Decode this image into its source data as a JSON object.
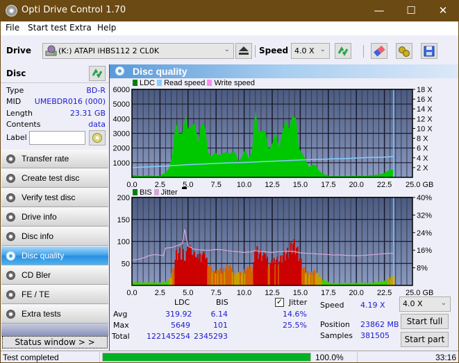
{
  "window": {
    "title": "Opti Drive Control 1.70",
    "controls": {
      "minimize": "—",
      "maximize": "☐",
      "close": "✕"
    }
  },
  "menu": [
    "File",
    "Start test",
    "Extra",
    "Help"
  ],
  "toolbar": {
    "drive_label": "Drive",
    "drive_value": "(K:)  ATAPI iHBS112  2 CL0K",
    "speed_label": "Speed",
    "speed_value": "4.0 X",
    "icons": [
      "drive-icon",
      "eject-icon",
      "refresh-icon",
      "eraser-icon",
      "settings-icon",
      "save-icon"
    ]
  },
  "disc": {
    "header": "Disc",
    "rows": [
      {
        "key": "Type",
        "value": "BD-R"
      },
      {
        "key": "MID",
        "value": "UMEBDR016 (000)"
      },
      {
        "key": "Length",
        "value": "23.31 GB"
      },
      {
        "key": "Contents",
        "value": "data"
      }
    ],
    "label_key": "Label",
    "label_value": ""
  },
  "nav": [
    {
      "label": "Transfer rate",
      "active": false
    },
    {
      "label": "Create test disc",
      "active": false
    },
    {
      "label": "Verify test disc",
      "active": false
    },
    {
      "label": "Drive info",
      "active": false
    },
    {
      "label": "Disc info",
      "active": false
    },
    {
      "label": "Disc quality",
      "active": true
    },
    {
      "label": "CD Bler",
      "active": false
    },
    {
      "label": "FE / TE",
      "active": false
    },
    {
      "label": "Extra tests",
      "active": false
    }
  ],
  "status_window_button": "Status window > >",
  "panel_title": "Disc quality",
  "chart_data": [
    {
      "type": "area",
      "title": "LDC / Read speed",
      "legend": [
        {
          "name": "LDC",
          "color": "#00a000"
        },
        {
          "name": "Read speed",
          "color": "#88ccff"
        },
        {
          "name": "Write speed",
          "color": "#ff88ee"
        }
      ],
      "legend_position": "top-left",
      "xlabel": "GB",
      "x_ticks": [
        "0.0",
        "2.5",
        "5.0",
        "7.5",
        "10.0",
        "12.5",
        "15.0",
        "17.5",
        "20.0",
        "22.5",
        "25.0 GB"
      ],
      "xlim": [
        0,
        25
      ],
      "y_left_ticks": [
        "1000",
        "2000",
        "3000",
        "4000",
        "5000",
        "6000"
      ],
      "ylim_left": [
        0,
        6000
      ],
      "y_right_ticks": [
        "2 X",
        "4 X",
        "6 X",
        "8 X",
        "10 X",
        "12 X",
        "14 X",
        "16 X",
        "18 X"
      ],
      "ylim_right": [
        0,
        18
      ],
      "grid": true,
      "end_marker_x": 23.31,
      "series": [
        {
          "name": "LDC",
          "x": [
            0,
            0.5,
            1,
            1.5,
            2,
            2.5,
            3,
            3.3,
            3.6,
            3.9,
            4.2,
            4.5,
            4.8,
            5.0,
            5.3,
            5.6,
            5.9,
            6.2,
            6.5,
            6.8,
            7.1,
            7.4,
            7.7,
            8.0,
            8.3,
            8.6,
            8.9,
            9.2,
            9.5,
            9.8,
            10.1,
            10.4,
            10.7,
            11.0,
            11.3,
            11.6,
            11.9,
            12.2,
            12.5,
            12.8,
            13.1,
            13.4,
            13.7,
            14.0,
            14.3,
            14.6,
            14.9,
            15.2,
            15.5,
            15.8,
            16.1,
            16.4,
            16.7,
            17.0,
            17.3,
            17.6,
            18,
            18.5,
            19,
            19.5,
            20,
            20.5,
            21,
            21.5,
            22,
            22.5,
            23,
            23.31
          ],
          "values": [
            150,
            120,
            100,
            130,
            90,
            110,
            300,
            700,
            1600,
            3300,
            3500,
            3000,
            3700,
            3900,
            3500,
            3200,
            2800,
            3700,
            3000,
            2000,
            1400,
            1500,
            1800,
            1600,
            1500,
            1900,
            1700,
            1500,
            1300,
            1400,
            1700,
            1500,
            1800,
            4000,
            3600,
            3200,
            2700,
            2200,
            2300,
            2700,
            2400,
            3100,
            3400,
            3900,
            4200,
            3500,
            2300,
            1600,
            1000,
            800,
            900,
            700,
            500,
            250,
            150,
            100,
            80,
            70,
            90,
            80,
            100,
            120,
            110,
            150,
            200,
            300,
            450,
            600
          ]
        },
        {
          "name": "Read speed",
          "x": [
            0,
            1,
            2,
            3,
            4,
            5,
            6,
            7,
            8,
            9,
            10,
            11,
            12,
            13,
            14,
            15,
            16,
            17,
            18,
            19,
            20,
            21,
            22,
            23,
            23.31
          ],
          "values": [
            2.0,
            2.1,
            2.2,
            2.3,
            2.45,
            2.6,
            2.7,
            2.8,
            2.9,
            3.0,
            3.05,
            3.15,
            3.25,
            3.35,
            3.45,
            3.55,
            3.65,
            3.7,
            3.8,
            3.85,
            3.95,
            4.05,
            4.1,
            4.2,
            4.3
          ]
        }
      ]
    },
    {
      "type": "bar",
      "title": "BIS / Jitter",
      "legend": [
        {
          "name": "BIS",
          "color": "#00a000"
        },
        {
          "name": "Jitter",
          "color": "#d8a8d8"
        }
      ],
      "legend_position": "top-left",
      "xlabel": "GB",
      "x_ticks": [
        "0.0",
        "2.5",
        "5.0",
        "7.5",
        "10.0",
        "12.5",
        "15.0",
        "17.5",
        "20.0",
        "22.5",
        "25.0 GB"
      ],
      "xlim": [
        0,
        25
      ],
      "y_left_ticks": [
        "50",
        "100",
        "150",
        "200"
      ],
      "ylim_left": [
        0,
        200
      ],
      "y_right_ticks": [
        "8%",
        "16%",
        "24%",
        "32%",
        "40%"
      ],
      "ylim_right": [
        0,
        40
      ],
      "grid": true,
      "end_marker_x": 23.31,
      "series": [
        {
          "name": "BIS",
          "x": [
            0,
            0.5,
            1,
            1.5,
            2,
            2.5,
            3,
            3.3,
            3.6,
            3.9,
            4.2,
            4.5,
            4.8,
            5.0,
            5.3,
            5.6,
            5.9,
            6.2,
            6.5,
            6.8,
            7.1,
            7.4,
            7.7,
            8.0,
            8.3,
            8.6,
            8.9,
            9.2,
            9.5,
            9.8,
            10.1,
            10.4,
            10.7,
            11.0,
            11.3,
            11.6,
            11.9,
            12.2,
            12.5,
            12.8,
            13.1,
            13.4,
            13.7,
            14.0,
            14.3,
            14.6,
            14.9,
            15.2,
            15.5,
            15.8,
            16.1,
            16.4,
            16.7,
            17.0,
            17.3,
            17.6,
            18,
            18.5,
            19,
            19.5,
            20,
            20.5,
            21,
            21.5,
            22,
            22.5,
            23,
            23.31
          ],
          "values": [
            8,
            7,
            6,
            7,
            6,
            6,
            8,
            15,
            35,
            70,
            75,
            72,
            68,
            85,
            70,
            65,
            60,
            70,
            60,
            45,
            30,
            28,
            35,
            32,
            40,
            45,
            30,
            28,
            25,
            30,
            35,
            38,
            40,
            80,
            72,
            68,
            60,
            50,
            52,
            58,
            55,
            68,
            72,
            80,
            95,
            85,
            60,
            40,
            30,
            25,
            32,
            28,
            20,
            12,
            8,
            6,
            5,
            5,
            6,
            5,
            6,
            6,
            5,
            7,
            8,
            10,
            18,
            22
          ]
        },
        {
          "name": "Jitter",
          "x": [
            0,
            0.5,
            1,
            1.5,
            2,
            2.5,
            2.8,
            3.0,
            3.5,
            4.0,
            4.5,
            4.7,
            5.0,
            5.5,
            6.0,
            6.5,
            7.0,
            7.5,
            8.0,
            8.5,
            9.0,
            9.5,
            10.0,
            10.5,
            11.0,
            11.5,
            12.0,
            12.5,
            13.0,
            13.5,
            14.0,
            14.5,
            15.0,
            15.5,
            16.0,
            16.5,
            17.0,
            17.5,
            18.0,
            18.5,
            19.0,
            19.5,
            20.0,
            20.5,
            21.0,
            21.5,
            22.0,
            22.5,
            23.0,
            23.31
          ],
          "values": [
            11.5,
            11.8,
            12.5,
            13.5,
            14.0,
            13.8,
            13.5,
            17.0,
            17.2,
            18.0,
            19.0,
            25.5,
            18.0,
            16.5,
            16.2,
            16.0,
            16.0,
            16.3,
            16.2,
            15.8,
            15.5,
            15.3,
            15.0,
            15.2,
            15.8,
            15.5,
            15.2,
            15.0,
            15.3,
            15.5,
            15.6,
            15.4,
            14.8,
            14.6,
            14.5,
            14.3,
            14.2,
            14.0,
            13.8,
            13.9,
            13.7,
            13.6,
            13.5,
            13.6,
            13.8,
            14.0,
            14.2,
            14.4,
            14.6,
            14.6
          ]
        }
      ]
    }
  ],
  "stats": {
    "col_ldc": "LDC",
    "col_bis": "BIS",
    "jitter_label": "Jitter",
    "jitter_checked": true,
    "rows": [
      {
        "label": "Avg",
        "ldc": "319.92",
        "bis": "6.14",
        "jitter": "14.6%"
      },
      {
        "label": "Max",
        "ldc": "5649",
        "bis": "101",
        "jitter": "25.5%"
      },
      {
        "label": "Total",
        "ldc": "122145254",
        "bis": "2345293",
        "jitter": ""
      }
    ],
    "speed_label": "Speed",
    "speed_value": "4.19 X",
    "position_label": "Position",
    "position_value": "23862 MB",
    "samples_label": "Samples",
    "samples_value": "381505",
    "speed_select": "4.0 X",
    "start_full": "Start full",
    "start_part": "Start part"
  },
  "statusbar": {
    "text": "Test completed",
    "progress": 1.0,
    "progress_text": "100.0%",
    "time": "33:16"
  }
}
